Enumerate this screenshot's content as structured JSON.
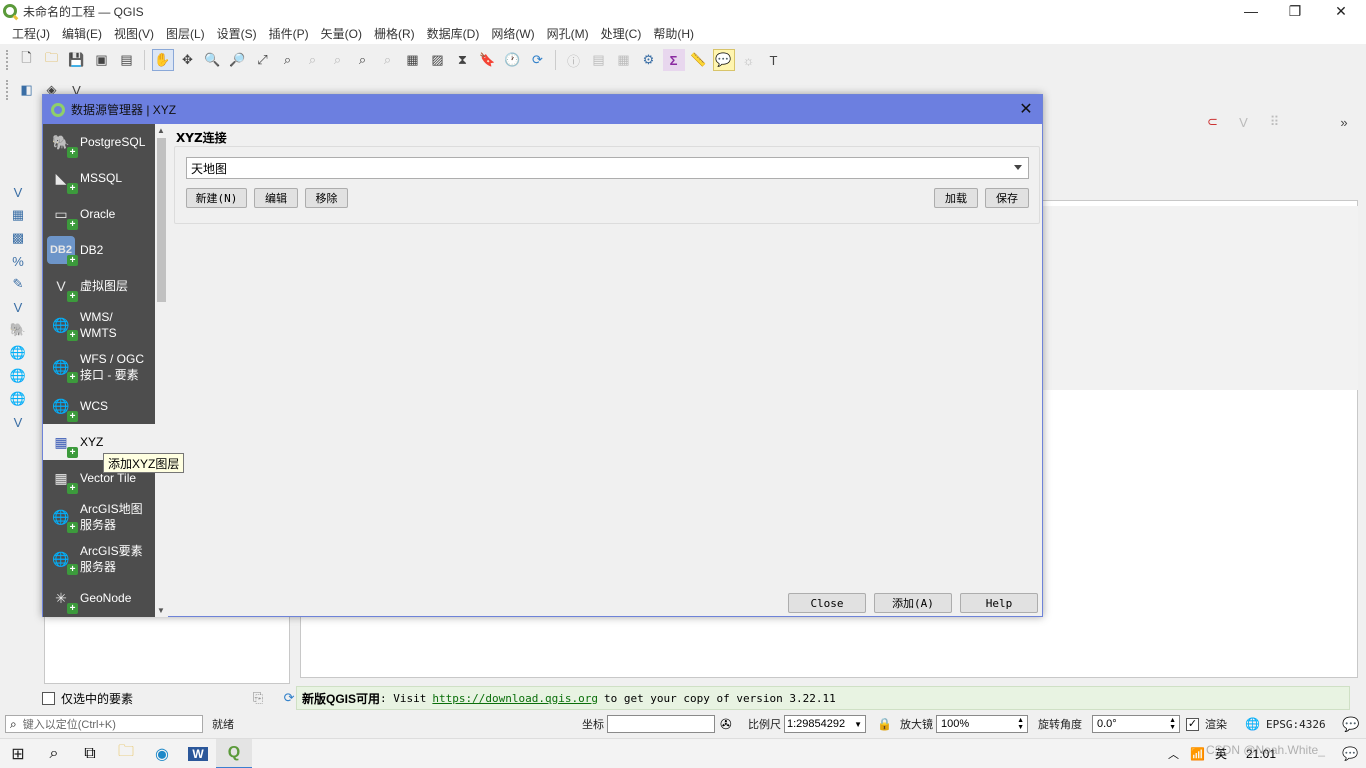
{
  "window": {
    "title": "未命名的工程 — QGIS",
    "minimize": "—",
    "restore": "❐",
    "close": "✕"
  },
  "menubar": [
    "工程(J)",
    "编辑(E)",
    "视图(V)",
    "图层(L)",
    "设置(S)",
    "插件(P)",
    "矢量(O)",
    "栅格(R)",
    "数据库(D)",
    "网络(W)",
    "网孔(M)",
    "处理(C)",
    "帮助(H)"
  ],
  "dialog": {
    "title": "数据源管理器 | XYZ",
    "close_glyph": "✕",
    "sidebar": [
      {
        "label": "PostgreSQL",
        "icon": "🐘"
      },
      {
        "label": "MSSQL",
        "icon": "◣"
      },
      {
        "label": "Oracle",
        "icon": "▭"
      },
      {
        "label": "DB2",
        "icon": "DB2"
      },
      {
        "label": "虚拟图层",
        "icon": "V"
      },
      {
        "label": "WMS/\nWMTS",
        "icon": "🌐"
      },
      {
        "label": "WFS / OGC\n接口 - 要素",
        "icon": "🌐"
      },
      {
        "label": "WCS",
        "icon": "🌐"
      },
      {
        "label": "XYZ",
        "icon": "▦"
      },
      {
        "label": "Vector Tile",
        "icon": "▦"
      },
      {
        "label": "ArcGIS地图\n服务器",
        "icon": "🌐"
      },
      {
        "label": "ArcGIS要素\n服务器",
        "icon": "🌐"
      },
      {
        "label": "GeoNode",
        "icon": "✳"
      }
    ],
    "selected_index": 8,
    "tooltip": "添加XYZ图层",
    "section_title": "XYZ连接",
    "connection_value": "天地图",
    "buttons": {
      "new": "新建(N)",
      "edit": "编辑",
      "remove": "移除",
      "load": "加载",
      "save": "保存",
      "close": "Close",
      "add": "添加(A)",
      "help": "Help"
    }
  },
  "selected_only_label": "仅选中的要素",
  "news": {
    "prefix": "新版QGIS可用",
    "text1": ": Visit",
    "link": "https://download.qgis.org",
    "text2": "to get your copy of version 3.22.11"
  },
  "status": {
    "locate_placeholder": "键入以定位(Ctrl+K)",
    "ready": "就绪",
    "coord_label": "坐标",
    "coord_value": "",
    "scale_label": "比例尺",
    "scale_value": "1:29854292",
    "magnifier_label": "放大镜",
    "magnifier_value": "100%",
    "rotation_label": "旋转角度",
    "rotation_value": "0.0°",
    "render_label": "渲染",
    "crs": "EPSG:4326"
  },
  "taskbar": {
    "ime": "英",
    "time": "21:01",
    "watermark": "CSDN @Noah.White_"
  }
}
